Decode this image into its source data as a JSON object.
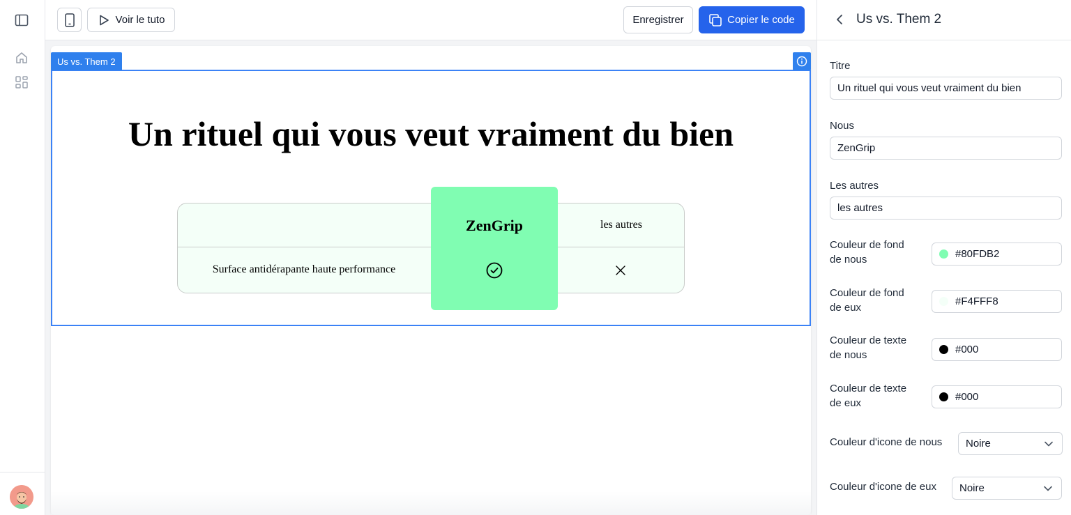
{
  "toolbar": {
    "tutorial_label": "Voir le tuto",
    "save_label": "Enregistrer",
    "copy_label": "Copier le code"
  },
  "section": {
    "tag": "Us vs. Them 2"
  },
  "preview": {
    "title": "Un rituel qui vous veut vraiment du bien",
    "us_header": "ZenGrip",
    "them_header": "les autres",
    "row_label": "Surface antidérapante haute performance",
    "us_bg": "#80FDB2",
    "them_bg": "#F4FFF8"
  },
  "panel": {
    "title": "Us vs. Them 2",
    "title_label": "Titre",
    "title_value": "Un rituel qui vous veut vraiment du bien",
    "us_label": "Nous",
    "us_value": "ZenGrip",
    "them_label": "Les autres",
    "them_value": "les autres",
    "us_bg_label_1": "Couleur de fond",
    "us_bg_label_2": "de nous",
    "us_bg_value": "#80FDB2",
    "them_bg_label_1": "Couleur de fond",
    "them_bg_label_2": "de eux",
    "them_bg_value": "#F4FFF8",
    "us_text_label_1": "Couleur de texte",
    "us_text_label_2": "de nous",
    "us_text_value": "#000",
    "them_text_label_1": "Couleur de texte",
    "them_text_label_2": "de eux",
    "them_text_value": "#000",
    "us_icon_label": "Couleur d'icone de nous",
    "us_icon_value": "Noire",
    "them_icon_label": "Couleur d'icone de eux",
    "them_icon_value": "Noire"
  }
}
